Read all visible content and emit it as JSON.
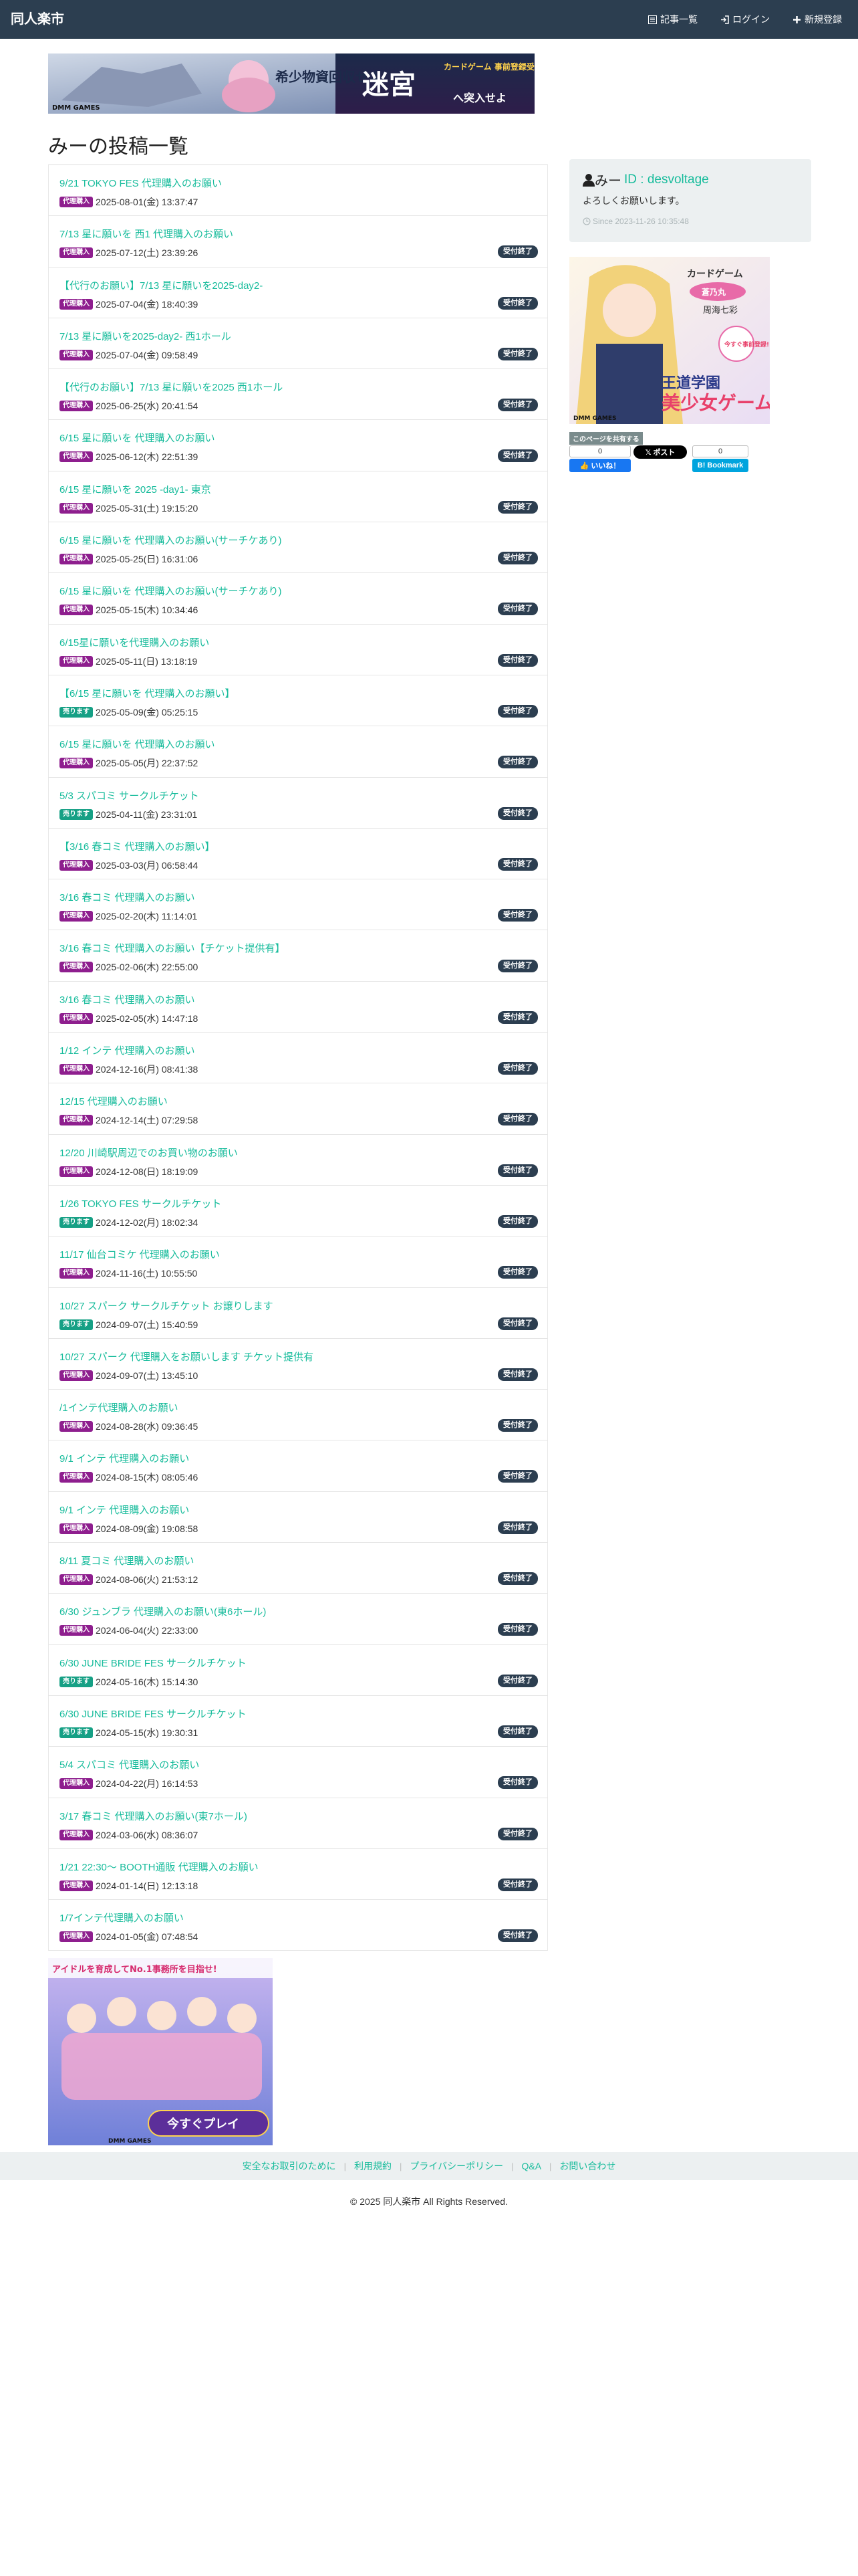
{
  "navbar": {
    "brand": "同人楽市",
    "links": [
      {
        "label": "記事一覧",
        "icon": "list-icon"
      },
      {
        "label": "ログイン",
        "icon": "sign-in-icon"
      },
      {
        "label": "新規登録",
        "icon": "plus-icon"
      }
    ]
  },
  "ad_top": {
    "caption": "希少物資回収せよ",
    "tag": "カードゲーム 事前登録受付中",
    "badge": "迷宮",
    "cta": "へ突入せよ",
    "brand": "DMM GAMES",
    "icon": "anime-banner-image"
  },
  "page_title": "みーの投稿一覧",
  "posts": [
    {
      "title": "9/21 TOKYO FES 代理購入のお願い",
      "tag": "代理購入",
      "tag_type": "buy",
      "date": "2025-08-01(金) 13:37:47",
      "status": ""
    },
    {
      "title": "7/13 星に願いを 西1 代理購入のお願い",
      "tag": "代理購入",
      "tag_type": "buy",
      "date": "2025-07-12(土) 23:39:26",
      "status": "受付終了"
    },
    {
      "title": "【代行のお願い】7/13 星に願いを2025-day2-",
      "tag": "代理購入",
      "tag_type": "buy",
      "date": "2025-07-04(金) 18:40:39",
      "status": "受付終了"
    },
    {
      "title": "7/13 星に願いを2025-day2- 西1ホール",
      "tag": "代理購入",
      "tag_type": "buy",
      "date": "2025-07-04(金) 09:58:49",
      "status": "受付終了"
    },
    {
      "title": "【代行のお願い】7/13 星に願いを2025 西1ホール",
      "tag": "代理購入",
      "tag_type": "buy",
      "date": "2025-06-25(水) 20:41:54",
      "status": "受付終了"
    },
    {
      "title": "6/15 星に願いを 代理購入のお願い",
      "tag": "代理購入",
      "tag_type": "buy",
      "date": "2025-06-12(木) 22:51:39",
      "status": "受付終了"
    },
    {
      "title": "6/15 星に願いを 2025 -day1- 東京",
      "tag": "代理購入",
      "tag_type": "buy",
      "date": "2025-05-31(土) 19:15:20",
      "status": "受付終了"
    },
    {
      "title": "6/15 星に願いを 代理購入のお願い(サーチケあり)",
      "tag": "代理購入",
      "tag_type": "buy",
      "date": "2025-05-25(日) 16:31:06",
      "status": "受付終了"
    },
    {
      "title": "6/15 星に願いを 代理購入のお願い(サーチケあり)",
      "tag": "代理購入",
      "tag_type": "buy",
      "date": "2025-05-15(木) 10:34:46",
      "status": "受付終了"
    },
    {
      "title": "6/15星に願いを代理購入のお願い",
      "tag": "代理購入",
      "tag_type": "buy",
      "date": "2025-05-11(日) 13:18:19",
      "status": "受付終了"
    },
    {
      "title": "【6/15 星に願いを 代理購入のお願い】",
      "tag": "売ります",
      "tag_type": "sell",
      "date": "2025-05-09(金) 05:25:15",
      "status": "受付終了"
    },
    {
      "title": "6/15 星に願いを 代理購入のお願い",
      "tag": "代理購入",
      "tag_type": "buy",
      "date": "2025-05-05(月) 22:37:52",
      "status": "受付終了"
    },
    {
      "title": "5/3 スパコミ サークルチケット",
      "tag": "売ります",
      "tag_type": "sell",
      "date": "2025-04-11(金) 23:31:01",
      "status": "受付終了"
    },
    {
      "title": "【3/16 春コミ 代理購入のお願い】",
      "tag": "代理購入",
      "tag_type": "buy",
      "date": "2025-03-03(月) 06:58:44",
      "status": "受付終了"
    },
    {
      "title": "3/16 春コミ 代理購入のお願い",
      "tag": "代理購入",
      "tag_type": "buy",
      "date": "2025-02-20(木) 11:14:01",
      "status": "受付終了"
    },
    {
      "title": "3/16 春コミ 代理購入のお願い【チケット提供有】",
      "tag": "代理購入",
      "tag_type": "buy",
      "date": "2025-02-06(木) 22:55:00",
      "status": "受付終了"
    },
    {
      "title": "3/16 春コミ 代理購入のお願い",
      "tag": "代理購入",
      "tag_type": "buy",
      "date": "2025-02-05(水) 14:47:18",
      "status": "受付終了"
    },
    {
      "title": "1/12 インテ 代理購入のお願い",
      "tag": "代理購入",
      "tag_type": "buy",
      "date": "2024-12-16(月) 08:41:38",
      "status": "受付終了"
    },
    {
      "title": "12/15 代理購入のお願い",
      "tag": "代理購入",
      "tag_type": "buy",
      "date": "2024-12-14(土) 07:29:58",
      "status": "受付終了"
    },
    {
      "title": "12/20 川崎駅周辺でのお買い物のお願い",
      "tag": "代理購入",
      "tag_type": "buy",
      "date": "2024-12-08(日) 18:19:09",
      "status": "受付終了"
    },
    {
      "title": "1/26 TOKYO FES サークルチケット",
      "tag": "売ります",
      "tag_type": "sell",
      "date": "2024-12-02(月) 18:02:34",
      "status": "受付終了"
    },
    {
      "title": "11/17 仙台コミケ 代理購入のお願い",
      "tag": "代理購入",
      "tag_type": "buy",
      "date": "2024-11-16(土) 10:55:50",
      "status": "受付終了"
    },
    {
      "title": "10/27 スパーク サークルチケット お譲りします",
      "tag": "売ります",
      "tag_type": "sell",
      "date": "2024-09-07(土) 15:40:59",
      "status": "受付終了"
    },
    {
      "title": "10/27 スパーク 代理購入をお願いします チケット提供有",
      "tag": "代理購入",
      "tag_type": "buy",
      "date": "2024-09-07(土) 13:45:10",
      "status": "受付終了"
    },
    {
      "title": "/1インテ代理購入のお願い",
      "tag": "代理購入",
      "tag_type": "buy",
      "date": "2024-08-28(水) 09:36:45",
      "status": "受付終了"
    },
    {
      "title": "9/1 インテ 代理購入のお願い",
      "tag": "代理購入",
      "tag_type": "buy",
      "date": "2024-08-15(木) 08:05:46",
      "status": "受付終了"
    },
    {
      "title": "9/1 インテ 代理購入のお願い",
      "tag": "代理購入",
      "tag_type": "buy",
      "date": "2024-08-09(金) 19:08:58",
      "status": "受付終了"
    },
    {
      "title": "8/11 夏コミ 代理購入のお願い",
      "tag": "代理購入",
      "tag_type": "buy",
      "date": "2024-08-06(火) 21:53:12",
      "status": "受付終了"
    },
    {
      "title": "6/30 ジュンブラ 代理購入のお願い(東6ホール)",
      "tag": "代理購入",
      "tag_type": "buy",
      "date": "2024-06-04(火) 22:33:00",
      "status": "受付終了"
    },
    {
      "title": "6/30 JUNE BRIDE FES サークルチケット",
      "tag": "売ります",
      "tag_type": "sell",
      "date": "2024-05-16(木) 15:14:30",
      "status": "受付終了"
    },
    {
      "title": "6/30 JUNE BRIDE FES サークルチケット",
      "tag": "売ります",
      "tag_type": "sell",
      "date": "2024-05-15(水) 19:30:31",
      "status": "受付終了"
    },
    {
      "title": "5/4 スパコミ 代理購入のお願い",
      "tag": "代理購入",
      "tag_type": "buy",
      "date": "2024-04-22(月) 16:14:53",
      "status": "受付終了"
    },
    {
      "title": "3/17 春コミ 代理購入のお願い(東7ホール)",
      "tag": "代理購入",
      "tag_type": "buy",
      "date": "2024-03-06(水) 08:36:07",
      "status": "受付終了"
    },
    {
      "title": "1/21 22:30〜 BOOTH通販 代理購入のお願い",
      "tag": "代理購入",
      "tag_type": "buy",
      "date": "2024-01-14(日) 12:13:18",
      "status": "受付終了"
    },
    {
      "title": "1/7インテ代理購入のお願い",
      "tag": "代理購入",
      "tag_type": "buy",
      "date": "2024-01-05(金) 07:48:54",
      "status": "受付終了"
    }
  ],
  "profile": {
    "name": "みー",
    "id_label": "ID : desvoltage",
    "bio": "よろしくお願いします。",
    "since": "Since 2023-11-26 10:35:48"
  },
  "ad_side": {
    "brand": "カードゲーム",
    "subtitle": "蒼乃丸",
    "name": "周海七彩",
    "headline": "王道学園",
    "title": "美少女ゲーム",
    "cta": "今すぐ事前登録!",
    "footer": "DMM GAMES"
  },
  "share": {
    "label": "このページを共有する",
    "fb_count": "0",
    "fb_label": "いいね！",
    "x_label": "ポスト",
    "hb_count": "0",
    "hb_label": "Bookmark"
  },
  "ad_bottom": {
    "headline": "アイドルを育成してNo.1事務所を目指せ!",
    "cta": "今すぐプレイ",
    "footer": "DMM GAMES"
  },
  "footer": {
    "links": [
      "安全なお取引のために",
      "利用規約",
      "プライバシーポリシー",
      "Q&A",
      "お問い合わせ"
    ],
    "copyright": "© 2025 同人楽市 All Rights Reserved."
  },
  "colors": {
    "navbar": "#2c3e50",
    "link": "#18bc9c",
    "tag_buy": "#8e1e8e",
    "tag_sell": "#16a085",
    "status": "#2c3e50",
    "panel": "#ecf0f1"
  }
}
